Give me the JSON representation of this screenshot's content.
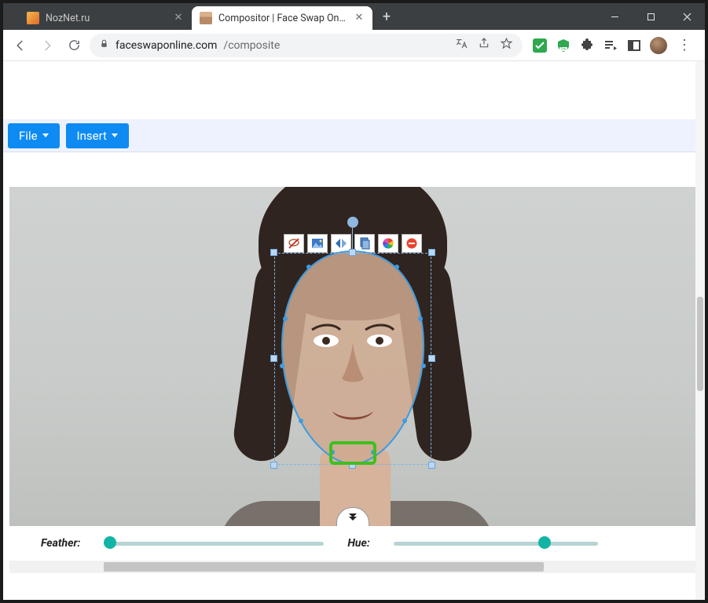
{
  "window": {
    "tabs": [
      {
        "title": "NozNet.ru",
        "active": false
      },
      {
        "title": "Compositor | Face Swap Online",
        "active": true
      }
    ]
  },
  "address": {
    "url_host": "faceswaponline.com",
    "url_path": "/composite"
  },
  "toolbar": {
    "file_label": "File",
    "insert_label": "Insert"
  },
  "mini_toolbar": {
    "items": [
      "lasso-disable-icon",
      "image-icon",
      "flip-horizontal-icon",
      "copy-icon",
      "color-wheel-icon",
      "delete-icon"
    ]
  },
  "sliders": {
    "feather_label": "Feather:",
    "feather_value": 0,
    "hue_label": "Hue:",
    "hue_value": 71
  }
}
